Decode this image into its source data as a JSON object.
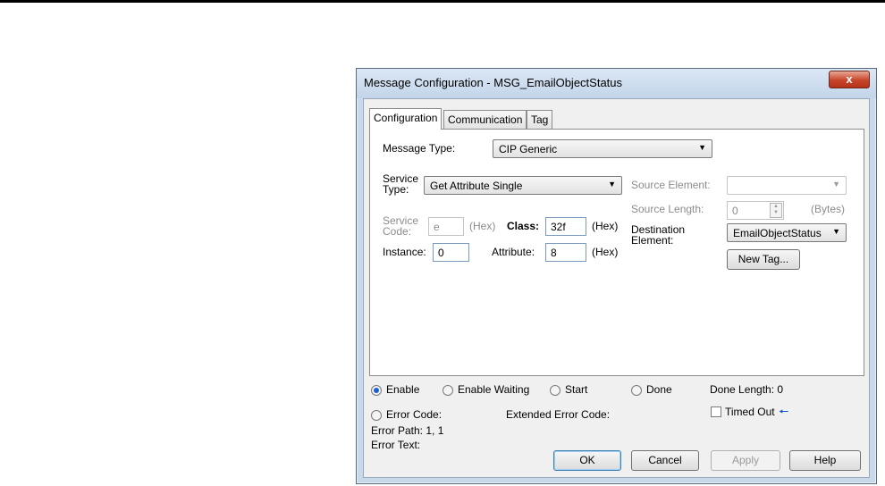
{
  "dialog": {
    "title": "Message Configuration - MSG_EmailObjectStatus",
    "close_glyph": "x"
  },
  "tabs": [
    {
      "label": "Configuration"
    },
    {
      "label": "Communication"
    },
    {
      "label": "Tag"
    }
  ],
  "config": {
    "message_type_label": "Message Type:",
    "message_type_value": "CIP Generic",
    "service_type_label_1": "Service",
    "service_type_label_2": "Type:",
    "service_type_value": "Get Attribute Single",
    "service_code_label_1": "Service",
    "service_code_label_2": "Code:",
    "service_code_value": "e",
    "hex_unit": "(Hex)",
    "class_label": "Class:",
    "class_value": "32f",
    "instance_label": "Instance:",
    "instance_value": "0",
    "attribute_label": "Attribute:",
    "attribute_value": "8",
    "source_element_label": "Source Element:",
    "source_element_value": "",
    "source_length_label": "Source Length:",
    "source_length_value": "0",
    "bytes_unit": "(Bytes)",
    "destination_label_1": "Destination",
    "destination_label_2": "Element:",
    "destination_value": "EmailObjectStatus",
    "new_tag_label": "New Tag..."
  },
  "status": {
    "enable": "Enable",
    "enable_waiting": "Enable Waiting",
    "start": "Start",
    "done": "Done",
    "done_length": "Done Length: 0",
    "error_code": "Error Code:",
    "extended_error_code": "Extended Error Code:",
    "timed_out": "Timed Out",
    "error_path": "Error Path: 1, 1",
    "error_text": "Error Text:"
  },
  "buttons": {
    "ok": "OK",
    "cancel": "Cancel",
    "apply": "Apply",
    "help": "Help"
  }
}
